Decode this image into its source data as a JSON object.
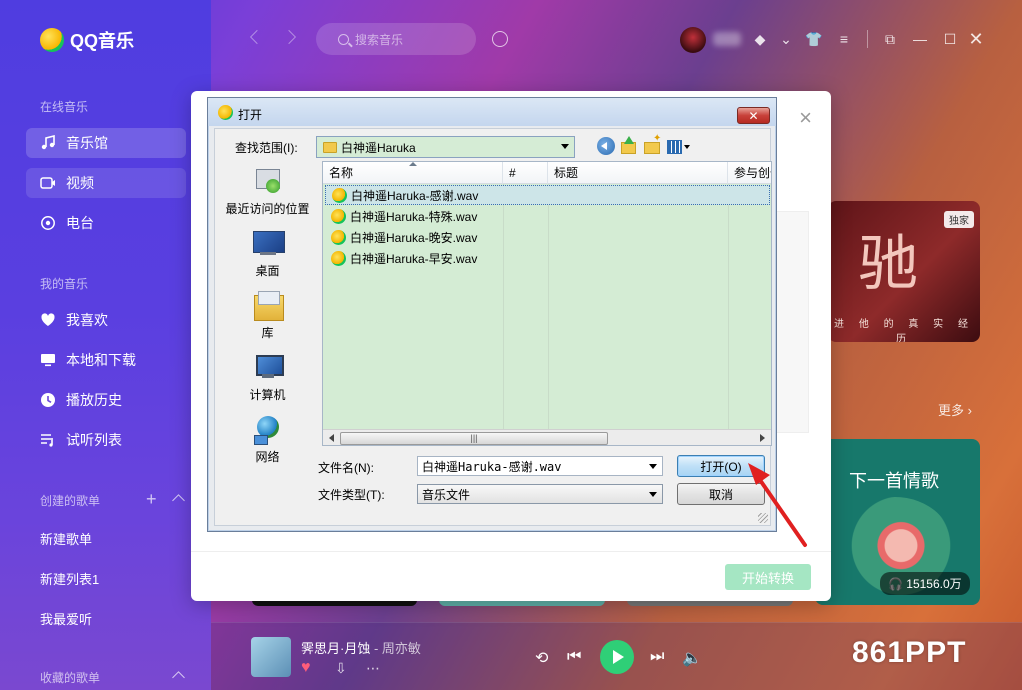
{
  "app": {
    "logo_text": "QQ音乐",
    "search_placeholder": "搜索音乐"
  },
  "sidebar": {
    "section_online": "在线音乐",
    "online_items": [
      {
        "label": "音乐馆",
        "icon": "music-note-icon"
      },
      {
        "label": "视频",
        "icon": "video-icon"
      },
      {
        "label": "电台",
        "icon": "radio-icon"
      }
    ],
    "section_mine": "我的音乐",
    "mine_items": [
      {
        "label": "我喜欢",
        "icon": "heart-icon"
      },
      {
        "label": "本地和下载",
        "icon": "monitor-icon"
      },
      {
        "label": "播放历史",
        "icon": "history-icon"
      },
      {
        "label": "试听列表",
        "icon": "playlist-icon"
      }
    ],
    "section_created": "创建的歌单",
    "created_items": [
      "新建歌单",
      "新建列表1",
      "我最爱听"
    ],
    "section_collected": "收藏的歌单"
  },
  "content": {
    "card1_badge": "独家",
    "card1_big": "驰",
    "card1_sub": "进 他 的 真 实 经 历",
    "more_label": "更多",
    "card2_title": "下一首情歌",
    "card2_count": "15156.0万"
  },
  "player": {
    "title": "霁思月·月蚀",
    "artist": "周亦敏",
    "watermark": "861PPT"
  },
  "modal": {
    "close_glyph": "×",
    "start_button": "开始转换"
  },
  "open_dialog": {
    "title": "打开",
    "close_glyph": "✕",
    "lookin_label": "查找范围(I):",
    "lookin_value": "白神遥Haruka",
    "places": [
      {
        "label": "最近访问的位置",
        "icon": "recent-places-icon"
      },
      {
        "label": "桌面",
        "icon": "desktop-icon"
      },
      {
        "label": "库",
        "icon": "libraries-icon"
      },
      {
        "label": "计算机",
        "icon": "computer-icon"
      },
      {
        "label": "网络",
        "icon": "network-icon"
      }
    ],
    "columns": [
      "名称",
      "#",
      "标题",
      "参与创作"
    ],
    "files": [
      "白神遥Haruka-感谢.wav",
      "白神遥Haruka-特殊.wav",
      "白神遥Haruka-晚安.wav",
      "白神遥Haruka-早安.wav"
    ],
    "scroll_grip": "|||",
    "filename_label": "文件名(N):",
    "filename_value": "白神遥Haruka-感谢.wav",
    "filetype_label": "文件类型(T):",
    "filetype_value": "音乐文件",
    "open_button": "打开(O)",
    "cancel_button": "取消"
  }
}
